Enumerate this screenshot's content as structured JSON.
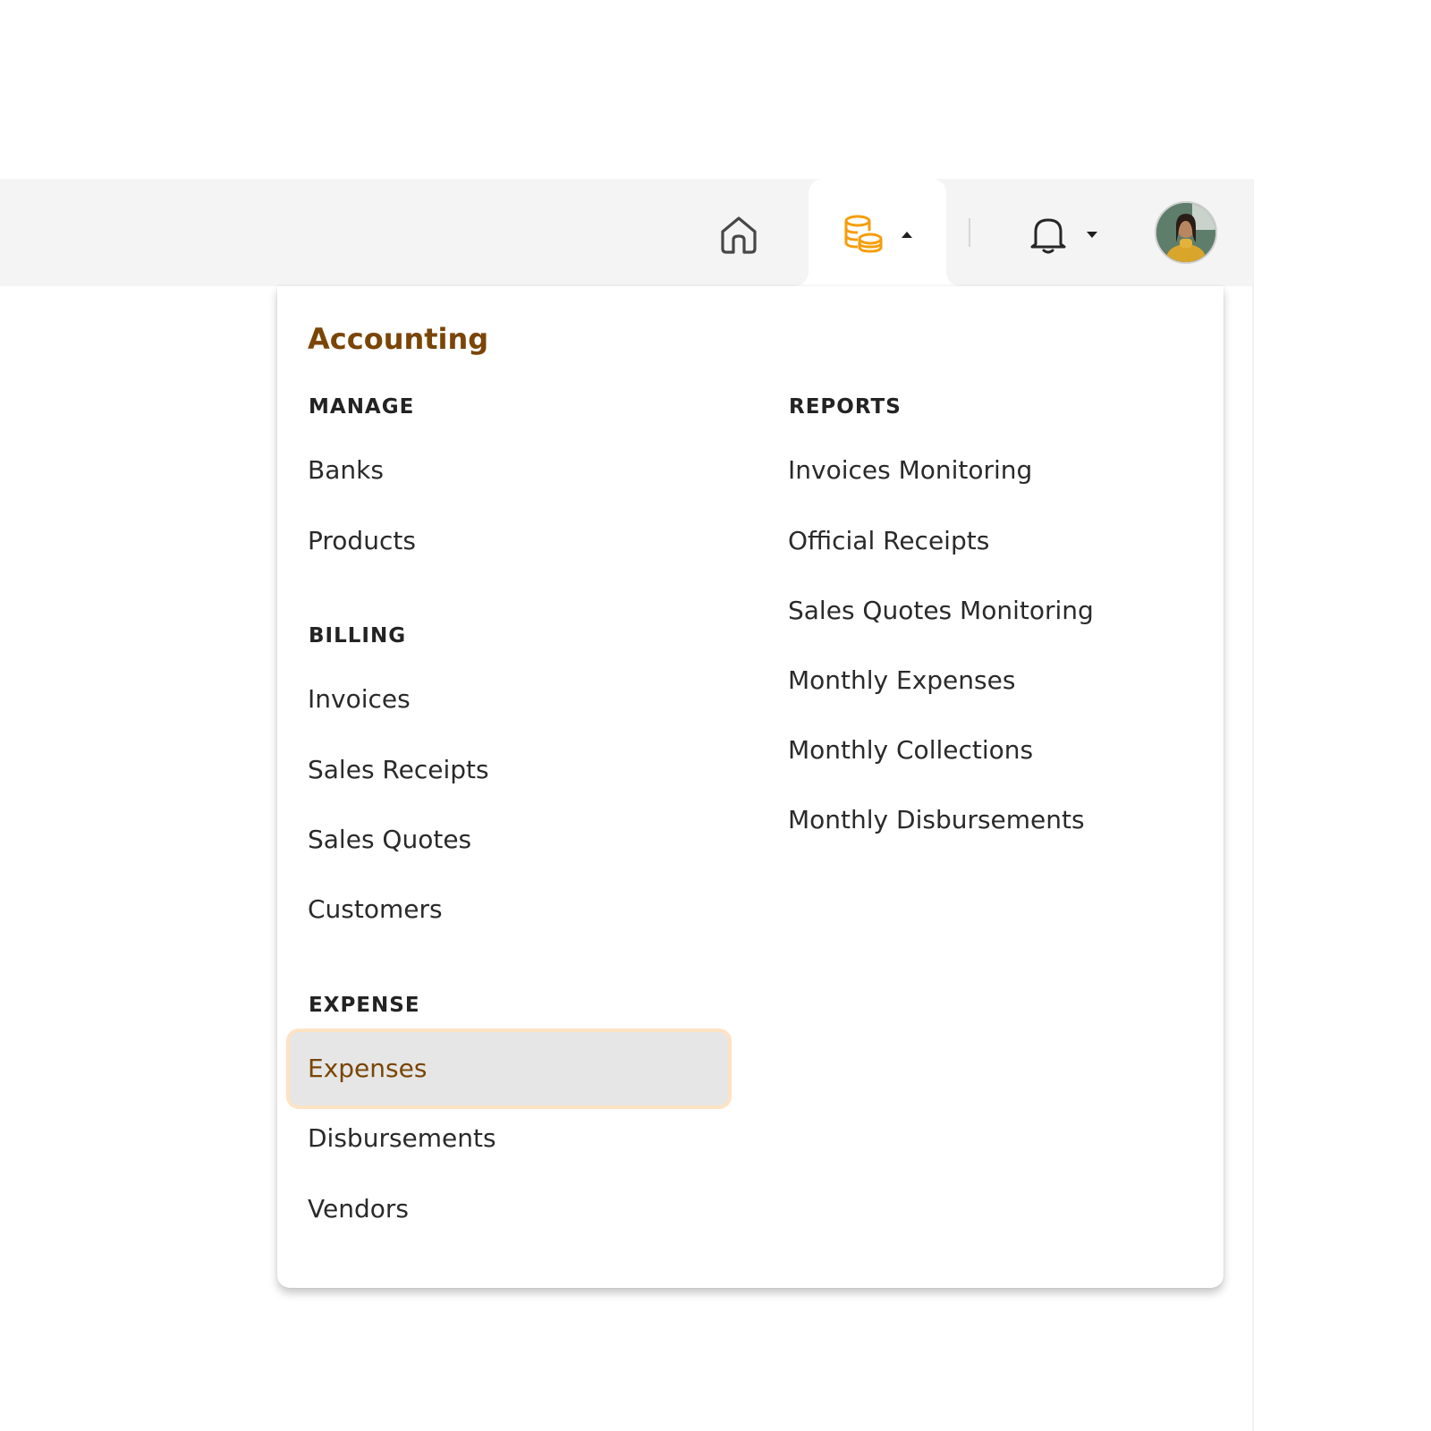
{
  "nav": {
    "home_icon": "home-icon",
    "accounting_icon": "coins-icon",
    "bell_icon": "bell-icon",
    "avatar_alt": "user avatar",
    "accent_color": "#f59e0b",
    "active_caret": "up"
  },
  "menu": {
    "title": "Accounting",
    "sections": {
      "manage": {
        "heading": "MANAGE",
        "items": [
          "Banks",
          "Products"
        ]
      },
      "billing": {
        "heading": "BILLING",
        "items": [
          "Invoices",
          "Sales Receipts",
          "Sales Quotes",
          "Customers"
        ]
      },
      "expense": {
        "heading": "EXPENSE",
        "items": [
          "Expenses",
          "Disbursements",
          "Vendors"
        ],
        "active_item": "Expenses"
      },
      "reports": {
        "heading": "REPORTS",
        "items": [
          "Invoices Monitoring",
          "Official Receipts",
          "Sales Quotes Monitoring",
          "Monthly Expenses",
          "Monthly Collections",
          "Monthly Disbursements"
        ]
      }
    },
    "title_color": "#7a4506",
    "highlight_border_color": "#fde3c4"
  }
}
